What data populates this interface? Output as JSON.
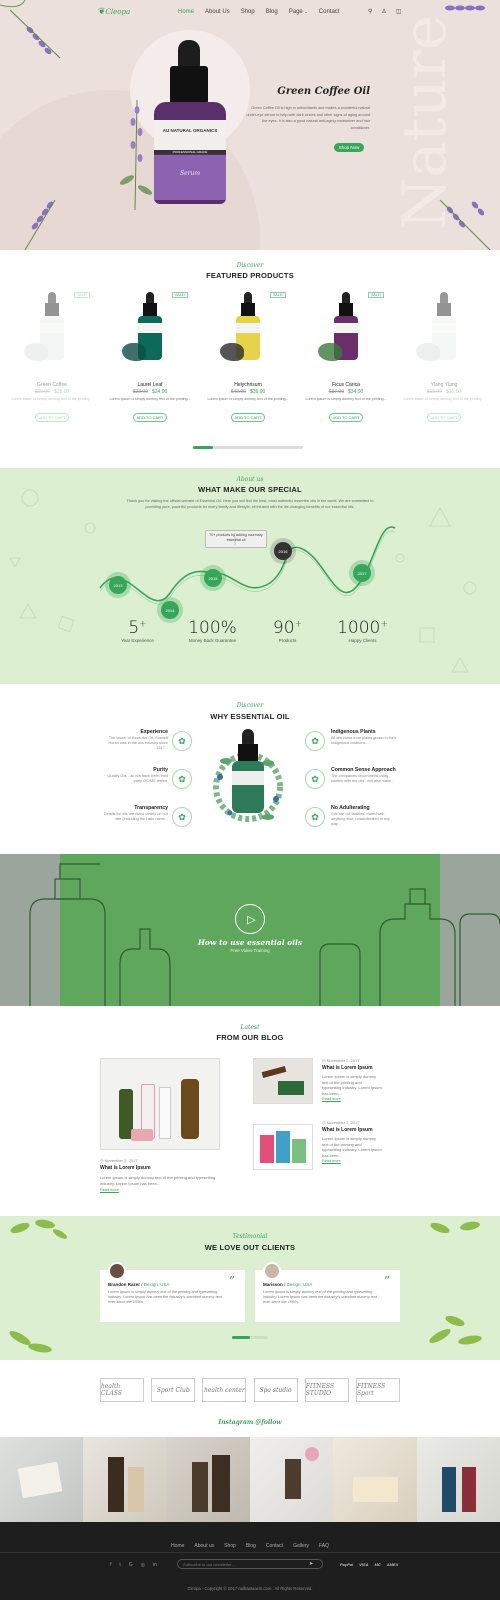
{
  "brand": {
    "name": "Cleopa"
  },
  "nav": {
    "items": [
      "Home",
      "About Us",
      "Shop",
      "Blog",
      "Page",
      "Contact"
    ],
    "active": "Home"
  },
  "icons": [
    "search-icon",
    "user-icon",
    "cart-icon"
  ],
  "hero": {
    "title": "Green Coffee Oil",
    "text": "Green Coffee Oil is high in antioxidants and makes a wonderful natural under-eye serum to help with dark circles and other signs of aging around the eyes. It is also a good natural anti-aging moisturizer and hair conditioner.",
    "button": "Shop Now",
    "watermark": "Nature",
    "label_brand": "AU NATURAL ORGANICS",
    "label_line": "PROFESSIONAL GRADE",
    "label_small": "Serum"
  },
  "featured": {
    "sub": "Discover",
    "title": "FEATURED PRODUCTS",
    "desc": "Lorem Ipsum is simply dummy text of the printing...",
    "add_to_cart": "ADD TO CART",
    "sale": "SALE!",
    "products": [
      {
        "name": "Green Coffee",
        "old": "$29.00",
        "price": "$25.00",
        "sale": true
      },
      {
        "name": "Laurel Leaf",
        "old": "$28.00",
        "price": "$24.00",
        "sale": true
      },
      {
        "name": "Helychrisum",
        "old": "$42.00",
        "price": "$39.00",
        "sale": true
      },
      {
        "name": "Ficus Carica",
        "old": "$37.00",
        "price": "$34.00",
        "sale": true
      },
      {
        "name": "Ylang Ylang",
        "old": "$18.00",
        "price": "$16.00",
        "sale": false
      }
    ]
  },
  "about": {
    "sub": "About us",
    "title": "WHAT MAKE OUR SPECIAL",
    "text": "Thank you for visiting the official website of Essential Oil. Here you will find the best, most authentic essential oils in the world. We are committed to providing pure, powerful products for every family and lifestyle, all infused with the life-changing benefits of our essential oils.",
    "tooltip": "70+ products by adding rosemary essential oil",
    "years": [
      "2013",
      "2014",
      "2015",
      "2016",
      "2017"
    ],
    "stats": [
      {
        "num": "5",
        "sup": "+",
        "label": "Year Experience"
      },
      {
        "num": "100%",
        "sup": "",
        "label": "Money Back Guarantee"
      },
      {
        "num": "90",
        "sup": "+",
        "label": "Products"
      },
      {
        "num": "1000",
        "sup": "+",
        "label": "Happy Clients"
      }
    ]
  },
  "why": {
    "sub": "Discover",
    "title": "WHY ESSENTIAL OIL",
    "left": [
      {
        "title": "Experience",
        "text": "The owner of Essential Oil, Scarlett Horan was in the oils industry since 1617...",
        "icon": "bottle-icon"
      },
      {
        "title": "Purity",
        "text": "Quality Oils - all oils have been third party GC/MS tested.",
        "icon": "drop-icon"
      },
      {
        "title": "Transparency",
        "text": "Details for oils are listed clearly on our site (including the Latin name...",
        "icon": "leaf-icon"
      }
    ],
    "right": [
      {
        "title": "Indigenous Plants",
        "text": "All oils come from plants grown in their indigenous locations...",
        "icon": "plant-icon"
      },
      {
        "title": "Common Sense Approach",
        "text": "The companies recommend using caution with the oils - but also make...",
        "icon": "flask-icon"
      },
      {
        "title": "No Adulterating",
        "text": "Oils are not falsified, mixed with anything else, unadulterated in any way...",
        "icon": "ban-icon"
      }
    ]
  },
  "video": {
    "title": "How to use essential oils",
    "sub": "Free Video Training"
  },
  "blog": {
    "sub": "Latest",
    "title": "FROM OUR BLOG",
    "main": {
      "date": "November 2, 2017",
      "title": "What is Lorem Ipsum",
      "text": "Lorem Ipsum is simply dummy text of the printing and typesetting industry. Lorem Ipsum has been...",
      "read": "Read more"
    },
    "side": [
      {
        "date": "November 2, 2017",
        "title": "What is Lorem Ipsum",
        "text": "Lorem Ipsum is simply dummy text of the printing and typesetting industry. Lorem Ipsum has been...",
        "read": "Read more"
      },
      {
        "date": "November 2, 2017",
        "title": "What is Lorem Ipsum",
        "text": "Lorem Ipsum is simply dummy text of the printing and typesetting industry. Lorem Ipsum has been...",
        "read": "Read more"
      }
    ]
  },
  "testimonial": {
    "sub": "Testimonial",
    "title": "WE LOVE OUT CLIENTS",
    "items": [
      {
        "name": "Brandon Razer",
        "role": "Design, USA",
        "text": "Lorem Ipsum is simply dummy text of the printing and typesetting industry. Lorem Ipsum has been the industry's standard dummy text ever since the 1500s."
      },
      {
        "name": "Marisson",
        "role": "Design, USA",
        "text": "Lorem Ipsum is simply dummy text of the printing and typesetting industry. Lorem Ipsum has been the industry's standard dummy text ever since the 1500s."
      }
    ]
  },
  "partners": [
    "health CLASS",
    "Sport Club",
    "health center",
    "Spa studio",
    "FITNESS STUDIO",
    "FITNESS Sport"
  ],
  "instagram": {
    "title": "Instagram @follow"
  },
  "footer": {
    "nav": [
      "Home",
      "About us",
      "Shop",
      "Blog",
      "Contact",
      "Gallery",
      "FAQ"
    ],
    "subscribe_placeholder": "Subscribe to our newsletter...",
    "payments": [
      "PayPal",
      "VISA",
      "MC",
      "AMEX"
    ],
    "copyright": "Cleopa - Copyright © 2017 nalbaataaxm.com . All Rights Reserved."
  },
  "colors": {
    "accent": "#35a65a",
    "hero_bg": "#ece0dc",
    "green_bg": "#dcefd0",
    "footer_bg": "#1e1e1e"
  }
}
